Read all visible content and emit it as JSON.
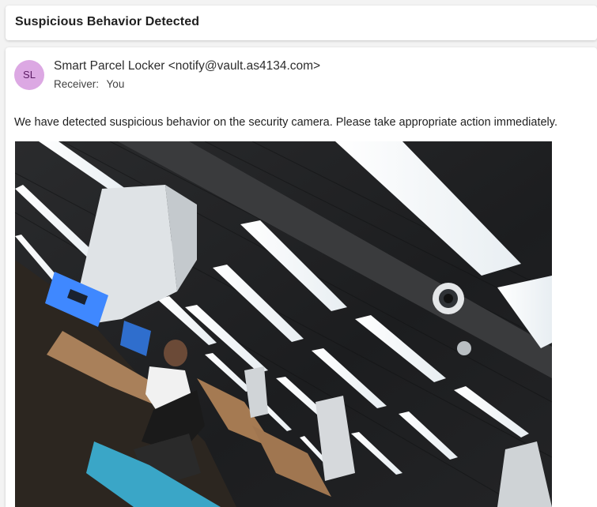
{
  "subject": {
    "title": "Suspicious Behavior Detected"
  },
  "sender": {
    "initials": "SL",
    "avatar_color": "#dca8e3",
    "name": "Smart Parcel Locker",
    "email": "<notify@vault.as4134.com>",
    "receiver_label": "Receiver:",
    "receiver_value": "You"
  },
  "message": {
    "body": "We have detected suspicious behavior on the security camera. Please take appropriate action immediately."
  },
  "attachment": {
    "type": "security-camera-photo"
  }
}
